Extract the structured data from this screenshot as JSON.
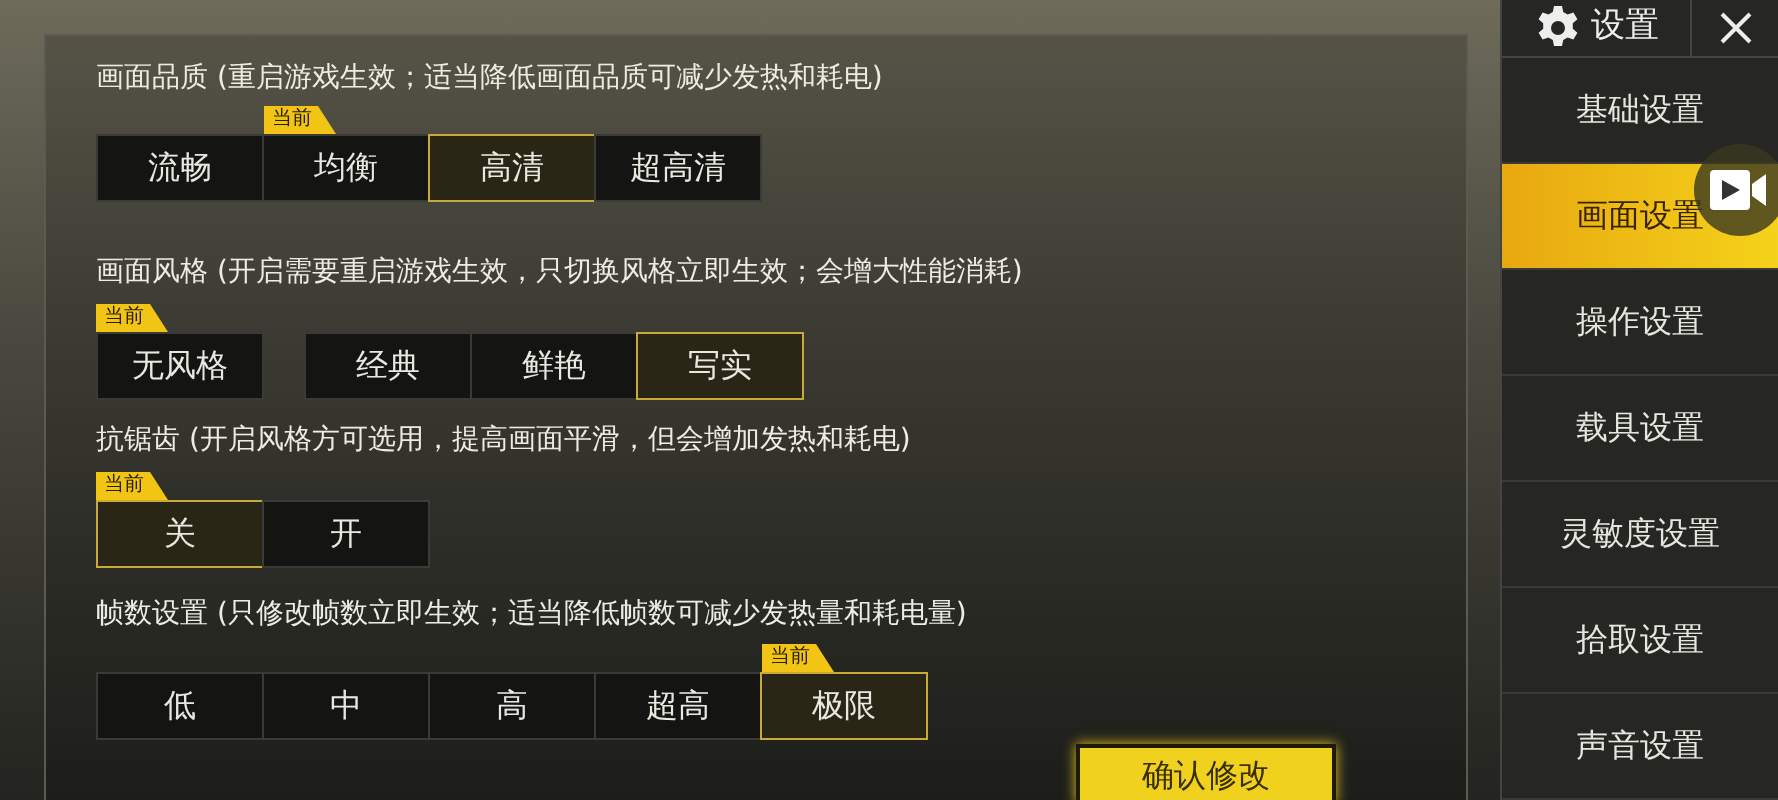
{
  "sections": [
    {
      "title": "画面品质 (重启游戏生效；适当降低画面品质可减少发热和耗电)",
      "groups": [
        [
          {
            "label": "流畅",
            "selected": false
          },
          {
            "label": "均衡",
            "selected": false,
            "badge": "当前"
          },
          {
            "label": "高清",
            "selected": true
          },
          {
            "label": "超高清",
            "selected": false
          }
        ]
      ]
    },
    {
      "title": "画面风格 (开启需要重启游戏生效，只切换风格立即生效；会增大性能消耗)",
      "groups": [
        [
          {
            "label": "无风格",
            "selected": false,
            "badge": "当前"
          }
        ],
        [
          {
            "label": "经典",
            "selected": false
          },
          {
            "label": "鲜艳",
            "selected": false
          },
          {
            "label": "写实",
            "selected": true
          }
        ]
      ]
    },
    {
      "title": "抗锯齿 (开启风格方可选用，提高画面平滑，但会增加发热和耗电)",
      "groups": [
        [
          {
            "label": "关",
            "selected": true,
            "badge": "当前"
          },
          {
            "label": "开",
            "selected": false
          }
        ]
      ]
    },
    {
      "title": "帧数设置 (只修改帧数立即生效；适当降低帧数可减少发热量和耗电量)",
      "groups": [
        [
          {
            "label": "低",
            "selected": false
          },
          {
            "label": "中",
            "selected": false
          },
          {
            "label": "高",
            "selected": false
          },
          {
            "label": "超高",
            "selected": false
          },
          {
            "label": "极限",
            "selected": true,
            "badge": "当前"
          }
        ]
      ]
    }
  ],
  "confirm_button": "确认修改",
  "sidebar": {
    "title": "设置",
    "items": [
      {
        "label": "基础设置",
        "selected": false
      },
      {
        "label": "画面设置",
        "selected": true
      },
      {
        "label": "操作设置",
        "selected": false
      },
      {
        "label": "载具设置",
        "selected": false
      },
      {
        "label": "灵敏度设置",
        "selected": false
      },
      {
        "label": "拾取设置",
        "selected": false
      },
      {
        "label": "声音设置",
        "selected": false
      }
    ]
  }
}
